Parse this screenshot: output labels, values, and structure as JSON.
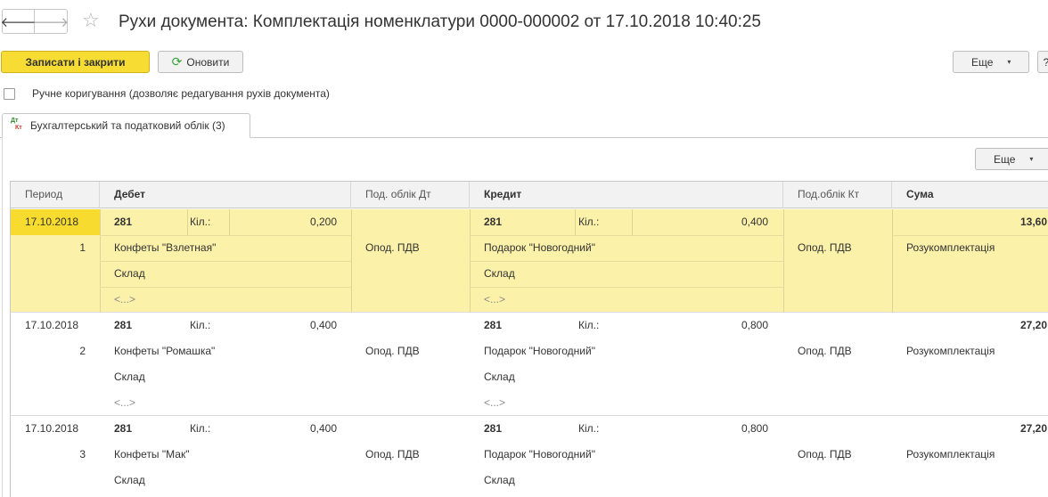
{
  "header": {
    "title": "Рухи документа: Комплектація номенклатури 0000-000002 от 17.10.2018 10:40:25",
    "back_glyph": "🡐",
    "forward_glyph": "🡒",
    "star_glyph": "☆"
  },
  "toolbar": {
    "save_close_label": "Записати і закрити",
    "refresh_label": "Оновити",
    "refresh_glyph": "⟳",
    "more_label": "Еще",
    "caret_glyph": "▾",
    "help_label": "?"
  },
  "manual_edit": {
    "label": "Ручне коригування (дозволяє редагування рухів документа)",
    "checked": false
  },
  "tab": {
    "label": "Бухгалтерський та податковий облік (3)",
    "icon_dt": "Дт",
    "icon_kt": "Кт"
  },
  "table_toolbar": {
    "more_label": "Еще"
  },
  "table": {
    "columns": {
      "period": "Период",
      "debit": "Дебет",
      "tax_dt": "Под. облік Дт",
      "credit": "Кредит",
      "tax_kt": "Под.облік Кт",
      "sum": "Сума"
    },
    "rows": [
      {
        "date": "17.10.2018",
        "num": "1",
        "dt_account": "281",
        "dt_qty_label": "Кіл.:",
        "dt_qty": "0,200",
        "dt_sub1": "Конфеты \"Взлетная\"",
        "dt_sub2": "Склад",
        "dt_sub3": "<...>",
        "tax_dt": "Опод. ПДВ",
        "kt_account": "281",
        "kt_qty_label": "Кіл.:",
        "kt_qty": "0,400",
        "kt_sub1": "Подарок \"Новогодний\"",
        "kt_sub2": "Склад",
        "kt_sub3": "<...>",
        "tax_kt": "Опод. ПДВ",
        "sum": "13,60",
        "content": "Розукомплектація"
      },
      {
        "date": "17.10.2018",
        "num": "2",
        "dt_account": "281",
        "dt_qty_label": "Кіл.:",
        "dt_qty": "0,400",
        "dt_sub1": "Конфеты \"Ромашка\"",
        "dt_sub2": "Склад",
        "dt_sub3": "<...>",
        "tax_dt": "Опод. ПДВ",
        "kt_account": "281",
        "kt_qty_label": "Кіл.:",
        "kt_qty": "0,800",
        "kt_sub1": "Подарок \"Новогодний\"",
        "kt_sub2": "Склад",
        "kt_sub3": "<...>",
        "tax_kt": "Опод. ПДВ",
        "sum": "27,20",
        "content": "Розукомплектація"
      },
      {
        "date": "17.10.2018",
        "num": "3",
        "dt_account": "281",
        "dt_qty_label": "Кіл.:",
        "dt_qty": "0,400",
        "dt_sub1": "Конфеты \"Мак\"",
        "dt_sub2": "Склад",
        "dt_sub3": "<...>",
        "tax_dt": "Опод. ПДВ",
        "kt_account": "281",
        "kt_qty_label": "Кіл.:",
        "kt_qty": "0,800",
        "kt_sub1": "Подарок \"Новогодний\"",
        "kt_sub2": "Склад",
        "kt_sub3": "<...>",
        "tax_kt": "Опод. ПДВ",
        "sum": "27,20",
        "content": "Розукомплектація"
      }
    ]
  },
  "colors": {
    "primary_button": "#f7dd33",
    "selected_row": "#fbf1a9",
    "selected_cell": "#f7dc2f",
    "refresh_icon": "#3aa13a"
  }
}
